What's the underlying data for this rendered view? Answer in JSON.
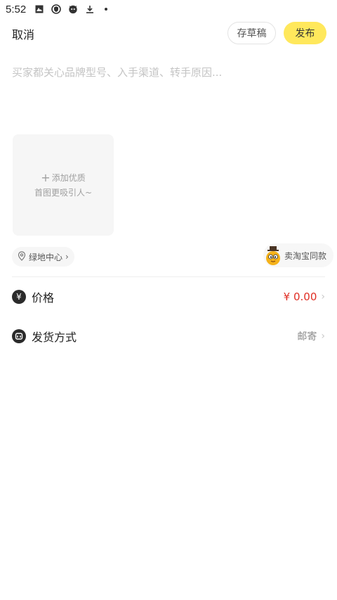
{
  "status_bar": {
    "time": "5:52"
  },
  "header": {
    "cancel_label": "取消",
    "draft_label": "存草稿",
    "publish_label": "发布"
  },
  "description": {
    "placeholder": "买家都关心品牌型号、入手渠道、转手原因..."
  },
  "photo": {
    "add_label": "添加优质",
    "hint": "首图更吸引人~"
  },
  "location": {
    "label": "绿地中心"
  },
  "same_style": {
    "label": "卖淘宝同款"
  },
  "price_row": {
    "label": "价格",
    "value": "¥ 0.00",
    "icon_glyph": "¥"
  },
  "shipping_row": {
    "label": "发货方式",
    "value": "邮寄"
  },
  "colors": {
    "accent": "#ffe85c",
    "price": "#e02e24"
  }
}
